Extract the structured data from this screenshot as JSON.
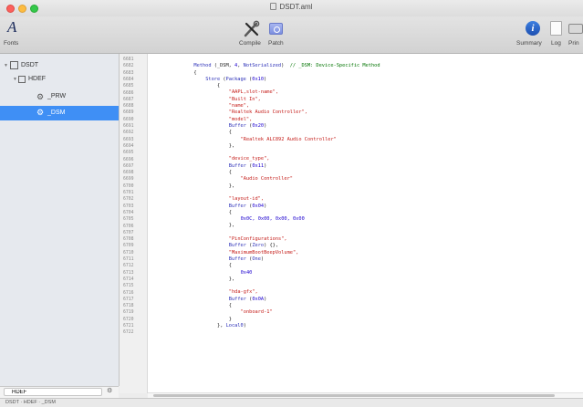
{
  "window": {
    "title": "DSDT.aml"
  },
  "toolbar": {
    "fonts_label": "Fonts",
    "compile_label": "Compile",
    "patch_label": "Patch",
    "summary_label": "Summary",
    "log_label": "Log",
    "print_label": "Prin"
  },
  "sidebar": {
    "items": [
      {
        "label": "DSDT"
      },
      {
        "label": "HDEF"
      },
      {
        "label": "_PRW"
      },
      {
        "label": "_DSM"
      }
    ],
    "search_value": "HDEF"
  },
  "pathbar": {
    "text": "DSDT · HDEF · _DSM"
  },
  "editor": {
    "line_numbers": [
      "6681",
      "6682",
      "6683",
      "6684",
      "6685",
      "6686",
      "6687",
      "6688",
      "6689",
      "6690",
      "6691",
      "6692",
      "6693",
      "6694",
      "6695",
      "6696",
      "6697",
      "6698",
      "6699",
      "6700",
      "6701",
      "6702",
      "6703",
      "6704",
      "6705",
      "6706",
      "6707",
      "6708",
      "6709",
      "6710",
      "6711",
      "6712",
      "6713",
      "6714",
      "6715",
      "6716",
      "6717",
      "6718",
      "6719",
      "6720",
      "6721",
      "6722"
    ],
    "lines": [
      {
        "indent": 0,
        "tokens": [
          {
            "t": "",
            "c": "pl"
          }
        ]
      },
      {
        "indent": 12,
        "tokens": [
          {
            "t": "Method",
            "c": "kw"
          },
          {
            "t": " (_DSM, ",
            "c": "pl"
          },
          {
            "t": "4",
            "c": "num"
          },
          {
            "t": ", ",
            "c": "pl"
          },
          {
            "t": "NotSerialized",
            "c": "kw"
          },
          {
            "t": ")  ",
            "c": "pl"
          },
          {
            "t": "// _DSM: Device-Specific Method",
            "c": "cm"
          }
        ]
      },
      {
        "indent": 12,
        "tokens": [
          {
            "t": "{",
            "c": "pl"
          }
        ]
      },
      {
        "indent": 16,
        "tokens": [
          {
            "t": "Store",
            "c": "kw"
          },
          {
            "t": " (",
            "c": "pl"
          },
          {
            "t": "Package",
            "c": "kw"
          },
          {
            "t": " (",
            "c": "pl"
          },
          {
            "t": "0x10",
            "c": "num"
          },
          {
            "t": ")",
            "c": "pl"
          }
        ]
      },
      {
        "indent": 20,
        "tokens": [
          {
            "t": "{",
            "c": "pl"
          }
        ]
      },
      {
        "indent": 24,
        "tokens": [
          {
            "t": "\"AAPL,slot-name\",",
            "c": "str"
          }
        ]
      },
      {
        "indent": 24,
        "tokens": [
          {
            "t": "\"Built In\",",
            "c": "str"
          }
        ]
      },
      {
        "indent": 24,
        "tokens": [
          {
            "t": "\"name\",",
            "c": "str"
          }
        ]
      },
      {
        "indent": 24,
        "tokens": [
          {
            "t": "\"Realtek Audio Controller\",",
            "c": "str"
          }
        ]
      },
      {
        "indent": 24,
        "tokens": [
          {
            "t": "\"model\",",
            "c": "str"
          }
        ]
      },
      {
        "indent": 24,
        "tokens": [
          {
            "t": "Buffer",
            "c": "kw"
          },
          {
            "t": " (",
            "c": "pl"
          },
          {
            "t": "0x20",
            "c": "num"
          },
          {
            "t": ")",
            "c": "pl"
          }
        ]
      },
      {
        "indent": 24,
        "tokens": [
          {
            "t": "{",
            "c": "pl"
          }
        ]
      },
      {
        "indent": 28,
        "tokens": [
          {
            "t": "\"Realtek ALC892 Audio Controller\"",
            "c": "str"
          }
        ]
      },
      {
        "indent": 24,
        "tokens": [
          {
            "t": "},",
            "c": "pl"
          }
        ]
      },
      {
        "indent": 0,
        "tokens": [
          {
            "t": "",
            "c": "pl"
          }
        ]
      },
      {
        "indent": 24,
        "tokens": [
          {
            "t": "\"device_type\",",
            "c": "str"
          }
        ]
      },
      {
        "indent": 24,
        "tokens": [
          {
            "t": "Buffer",
            "c": "kw"
          },
          {
            "t": " (",
            "c": "pl"
          },
          {
            "t": "0x11",
            "c": "num"
          },
          {
            "t": ")",
            "c": "pl"
          }
        ]
      },
      {
        "indent": 24,
        "tokens": [
          {
            "t": "{",
            "c": "pl"
          }
        ]
      },
      {
        "indent": 28,
        "tokens": [
          {
            "t": "\"Audio Controller\"",
            "c": "str"
          }
        ]
      },
      {
        "indent": 24,
        "tokens": [
          {
            "t": "},",
            "c": "pl"
          }
        ]
      },
      {
        "indent": 0,
        "tokens": [
          {
            "t": "",
            "c": "pl"
          }
        ]
      },
      {
        "indent": 24,
        "tokens": [
          {
            "t": "\"layout-id\",",
            "c": "str"
          }
        ]
      },
      {
        "indent": 24,
        "tokens": [
          {
            "t": "Buffer",
            "c": "kw"
          },
          {
            "t": " (",
            "c": "pl"
          },
          {
            "t": "0x04",
            "c": "num"
          },
          {
            "t": ")",
            "c": "pl"
          }
        ]
      },
      {
        "indent": 24,
        "tokens": [
          {
            "t": "{",
            "c": "pl"
          }
        ]
      },
      {
        "indent": 28,
        "tokens": [
          {
            "t": "0x0C, 0x00, 0x00, 0x00",
            "c": "num"
          }
        ]
      },
      {
        "indent": 24,
        "tokens": [
          {
            "t": "},",
            "c": "pl"
          }
        ]
      },
      {
        "indent": 0,
        "tokens": [
          {
            "t": "",
            "c": "pl"
          }
        ]
      },
      {
        "indent": 24,
        "tokens": [
          {
            "t": "\"PinConfigurations\",",
            "c": "str"
          }
        ]
      },
      {
        "indent": 24,
        "tokens": [
          {
            "t": "Buffer",
            "c": "kw"
          },
          {
            "t": " (",
            "c": "pl"
          },
          {
            "t": "Zero",
            "c": "kw"
          },
          {
            "t": ") {},",
            "c": "pl"
          }
        ]
      },
      {
        "indent": 24,
        "tokens": [
          {
            "t": "\"MaximumBootBeepVolume\",",
            "c": "str"
          }
        ]
      },
      {
        "indent": 24,
        "tokens": [
          {
            "t": "Buffer",
            "c": "kw"
          },
          {
            "t": " (",
            "c": "pl"
          },
          {
            "t": "One",
            "c": "kw"
          },
          {
            "t": ")",
            "c": "pl"
          }
        ]
      },
      {
        "indent": 24,
        "tokens": [
          {
            "t": "{",
            "c": "pl"
          }
        ]
      },
      {
        "indent": 28,
        "tokens": [
          {
            "t": "0x40",
            "c": "num"
          }
        ]
      },
      {
        "indent": 24,
        "tokens": [
          {
            "t": "},",
            "c": "pl"
          }
        ]
      },
      {
        "indent": 0,
        "tokens": [
          {
            "t": "",
            "c": "pl"
          }
        ]
      },
      {
        "indent": 24,
        "tokens": [
          {
            "t": "\"hda-gfx\",",
            "c": "str"
          }
        ]
      },
      {
        "indent": 24,
        "tokens": [
          {
            "t": "Buffer",
            "c": "kw"
          },
          {
            "t": " (",
            "c": "pl"
          },
          {
            "t": "0x0A",
            "c": "num"
          },
          {
            "t": ")",
            "c": "pl"
          }
        ]
      },
      {
        "indent": 24,
        "tokens": [
          {
            "t": "{",
            "c": "pl"
          }
        ]
      },
      {
        "indent": 28,
        "tokens": [
          {
            "t": "\"onboard-1\"",
            "c": "str"
          }
        ]
      },
      {
        "indent": 24,
        "tokens": [
          {
            "t": "}",
            "c": "pl"
          }
        ]
      },
      {
        "indent": 20,
        "tokens": [
          {
            "t": "}, ",
            "c": "pl"
          },
          {
            "t": "Local0",
            "c": "kw"
          },
          {
            "t": ")",
            "c": "pl"
          }
        ]
      },
      {
        "indent": 0,
        "tokens": [
          {
            "t": "",
            "c": "pl"
          }
        ]
      }
    ]
  },
  "colors": {
    "selection": "#3f8ff5",
    "keyword": "#2b2fb8",
    "string": "#c41a16",
    "number": "#1c00cf",
    "comment": "#007400"
  }
}
